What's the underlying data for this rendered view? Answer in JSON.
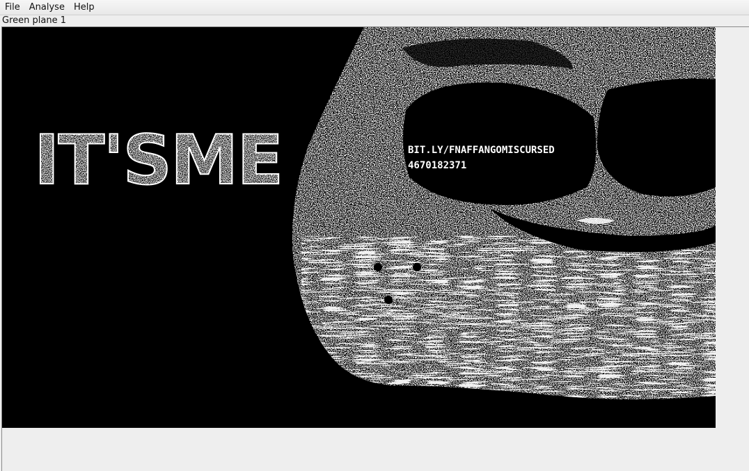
{
  "menubar": {
    "items": [
      {
        "label": "File"
      },
      {
        "label": "Analyse"
      },
      {
        "label": "Help"
      }
    ]
  },
  "view": {
    "plane_label": "Green plane 1"
  },
  "image": {
    "big_text": "IT'SME",
    "url_text": "BIT.LY/FNAFFANGOMISCURSED",
    "number_text": "4670182371"
  },
  "colors": {
    "background": "#000000",
    "noise": "#ffffff",
    "chrome": "#eeeeee"
  }
}
